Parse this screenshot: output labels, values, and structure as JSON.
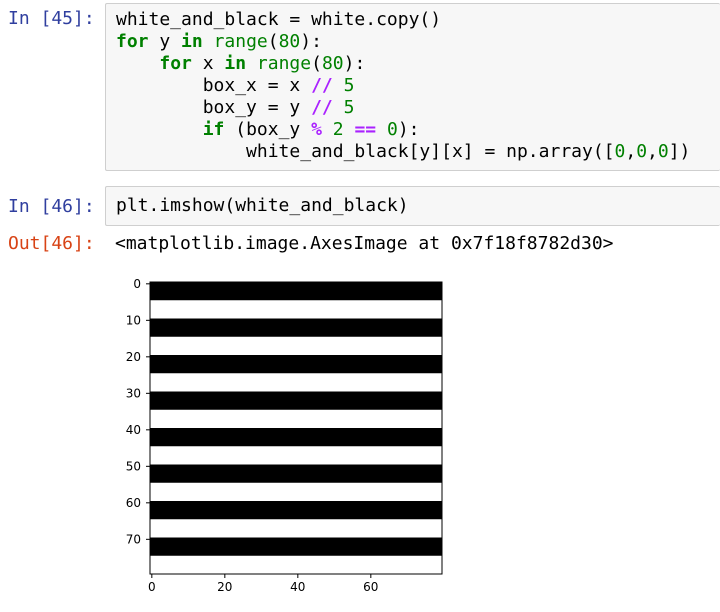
{
  "cell45": {
    "prompt": "In [45]:",
    "lines": [
      [
        {
          "t": "white_and_black = white.copy()",
          "c": ""
        }
      ],
      [
        {
          "t": "for",
          "c": "kw"
        },
        {
          "t": " y ",
          "c": ""
        },
        {
          "t": "in",
          "c": "kw"
        },
        {
          "t": " ",
          "c": ""
        },
        {
          "t": "range",
          "c": "bi"
        },
        {
          "t": "(",
          "c": ""
        },
        {
          "t": "80",
          "c": "num"
        },
        {
          "t": "):",
          "c": ""
        }
      ],
      [
        {
          "t": "    ",
          "c": ""
        },
        {
          "t": "for",
          "c": "kw"
        },
        {
          "t": " x ",
          "c": ""
        },
        {
          "t": "in",
          "c": "kw"
        },
        {
          "t": " ",
          "c": ""
        },
        {
          "t": "range",
          "c": "bi"
        },
        {
          "t": "(",
          "c": ""
        },
        {
          "t": "80",
          "c": "num"
        },
        {
          "t": "):",
          "c": ""
        }
      ],
      [
        {
          "t": "        box_x = x ",
          "c": ""
        },
        {
          "t": "//",
          "c": "op"
        },
        {
          "t": " ",
          "c": ""
        },
        {
          "t": "5",
          "c": "num"
        }
      ],
      [
        {
          "t": "        box_y = y ",
          "c": ""
        },
        {
          "t": "//",
          "c": "op"
        },
        {
          "t": " ",
          "c": ""
        },
        {
          "t": "5",
          "c": "num"
        }
      ],
      [
        {
          "t": "        ",
          "c": ""
        },
        {
          "t": "if",
          "c": "kw"
        },
        {
          "t": " (box_y ",
          "c": ""
        },
        {
          "t": "%",
          "c": "op"
        },
        {
          "t": " ",
          "c": ""
        },
        {
          "t": "2",
          "c": "num"
        },
        {
          "t": " ",
          "c": ""
        },
        {
          "t": "==",
          "c": "op"
        },
        {
          "t": " ",
          "c": ""
        },
        {
          "t": "0",
          "c": "num"
        },
        {
          "t": "):",
          "c": ""
        }
      ],
      [
        {
          "t": "            white_and_black[y][x] = np.array([",
          "c": ""
        },
        {
          "t": "0",
          "c": "num"
        },
        {
          "t": ",",
          "c": ""
        },
        {
          "t": "0",
          "c": "num"
        },
        {
          "t": ",",
          "c": ""
        },
        {
          "t": "0",
          "c": "num"
        },
        {
          "t": "])",
          "c": ""
        }
      ]
    ]
  },
  "cell46": {
    "prompt": "In [46]:",
    "code": "plt.imshow(white_and_black)",
    "out_prompt": "Out[46]:",
    "output_text": "<matplotlib.image.AxesImage at 0x7f18f8782d30>"
  },
  "chart_data": {
    "type": "heatmap",
    "description_source": "matplotlib imshow of 80x80 image",
    "image_size": [
      80,
      80
    ],
    "stripe_height": 5,
    "stripe_rows_black": [
      [
        0,
        4
      ],
      [
        10,
        14
      ],
      [
        20,
        24
      ],
      [
        30,
        34
      ],
      [
        40,
        44
      ],
      [
        50,
        54
      ],
      [
        60,
        64
      ],
      [
        70,
        74
      ]
    ],
    "stripe_rows_white": [
      [
        5,
        9
      ],
      [
        15,
        19
      ],
      [
        25,
        29
      ],
      [
        35,
        39
      ],
      [
        45,
        49
      ],
      [
        55,
        59
      ],
      [
        65,
        69
      ],
      [
        75,
        79
      ]
    ],
    "colors": {
      "black": "#000000",
      "white": "#ffffff"
    },
    "y_ticks": [
      0,
      10,
      20,
      30,
      40,
      50,
      60,
      70
    ],
    "x_ticks": [
      0,
      20,
      40,
      60
    ],
    "xlim": [
      0,
      80
    ],
    "ylim": [
      0,
      80
    ]
  }
}
